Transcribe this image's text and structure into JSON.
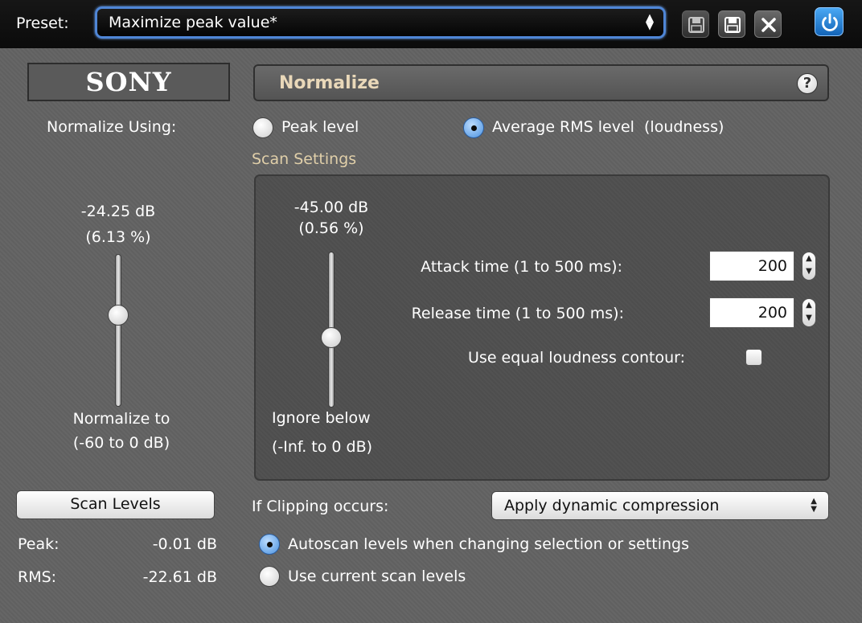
{
  "toolbar": {
    "preset_label": "Preset:",
    "preset_value": "Maximize peak value*",
    "save_icon": "save-icon",
    "save_as_icon": "save-as-icon",
    "delete_icon": "close-icon",
    "power_icon": "power-icon",
    "power_color": "#2a86d8"
  },
  "logo": {
    "text": "SONY"
  },
  "header": {
    "title": "Normalize",
    "help_glyph": "?"
  },
  "normalize_using": {
    "label": "Normalize Using:",
    "options": [
      {
        "label": "Peak level",
        "selected": false
      },
      {
        "label": "Average RMS level  (loudness)",
        "selected": true
      }
    ]
  },
  "normalize_slider": {
    "value_db": "-24.25 dB",
    "value_pct": "(6.13 %)",
    "label_line1": "Normalize to",
    "label_line2": "(-60 to 0 dB)",
    "level": 0.6
  },
  "scan_settings": {
    "title": "Scan Settings",
    "ignore_slider": {
      "value_db": "-45.00 dB",
      "value_pct": "(0.56 %)",
      "label_line1": "Ignore below",
      "label_line2": "(-Inf. to 0 dB)",
      "level": 0.45
    },
    "attack": {
      "label": "Attack time (1 to 500 ms):",
      "value": "200"
    },
    "release": {
      "label": "Release time (1 to 500 ms):",
      "value": "200"
    },
    "equal_loudness": {
      "label": "Use equal loudness contour:",
      "checked": false
    }
  },
  "scan_levels": {
    "button_label": "Scan Levels",
    "peak_label": "Peak:",
    "peak_value": "-0.01 dB",
    "rms_label": "RMS:",
    "rms_value": "-22.61 dB"
  },
  "clipping": {
    "label": "If Clipping occurs:",
    "selected": "Apply dynamic compression"
  },
  "scan_mode": {
    "options": [
      {
        "label": "Autoscan levels when changing selection or settings",
        "selected": true
      },
      {
        "label": "Use current scan levels",
        "selected": false
      }
    ]
  }
}
